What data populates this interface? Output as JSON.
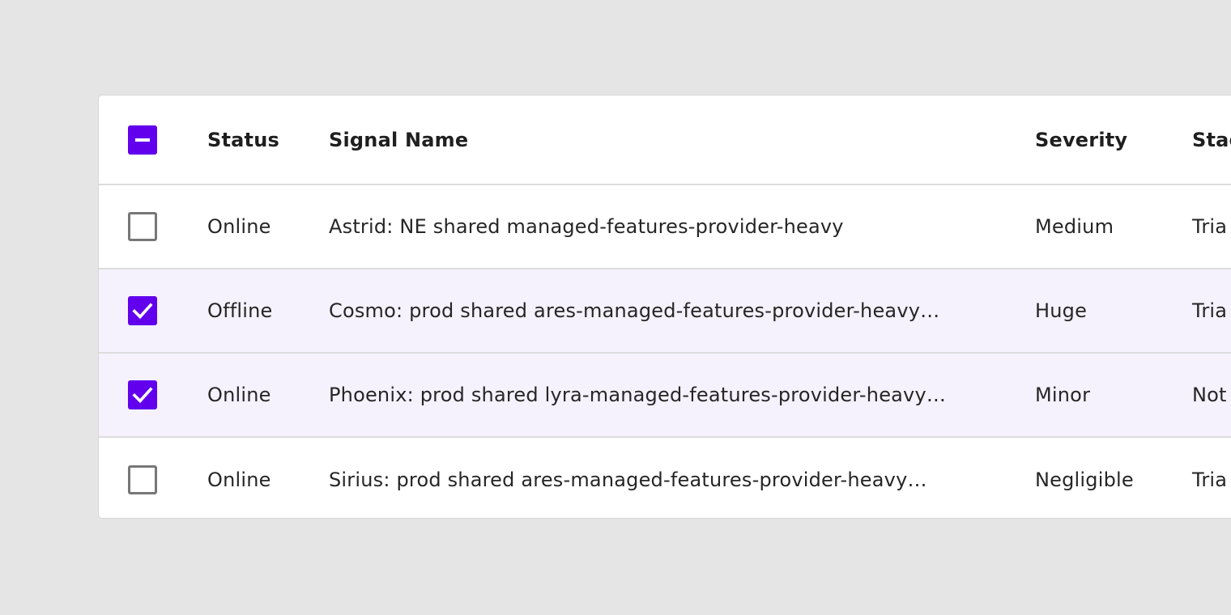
{
  "table": {
    "header": {
      "select_all_state": "indeterminate",
      "status": "Status",
      "signal_name": "Signal Name",
      "severity": "Severity",
      "stage": "Stag"
    },
    "rows": [
      {
        "checked": false,
        "status": "Online",
        "signal_name": "Astrid: NE shared managed-features-provider-heavy",
        "severity": "Medium",
        "stage": "Tria"
      },
      {
        "checked": true,
        "status": "Offline",
        "signal_name": "Cosmo: prod shared ares-managed-features-provider-heavy…",
        "severity": "Huge",
        "stage": "Tria"
      },
      {
        "checked": true,
        "status": "Online",
        "signal_name": "Phoenix: prod shared lyra-managed-features-provider-heavy…",
        "severity": "Minor",
        "stage": "Not"
      },
      {
        "checked": false,
        "status": "Online",
        "signal_name": "Sirius: prod shared ares-managed-features-provider-heavy…",
        "severity": "Negligible",
        "stage": "Tria"
      }
    ]
  },
  "colors": {
    "accent": "#6200ee",
    "selected_row_bg": "#f5f2fd",
    "page_bg": "#e5e5e5"
  },
  "icons": {
    "indeterminate": "minus-icon",
    "checked": "check-icon"
  }
}
